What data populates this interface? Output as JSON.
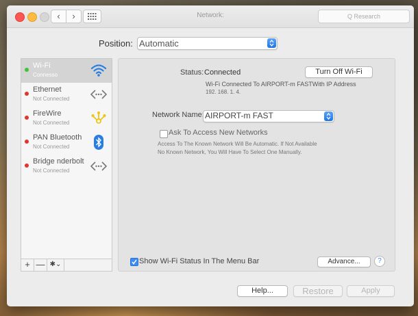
{
  "window": {
    "title": "Network:"
  },
  "toolbar": {
    "back_label": "‹",
    "forward_label": "›",
    "search_placeholder": "Q  Research"
  },
  "position": {
    "label": "Position:",
    "value": "Automatic"
  },
  "sidebar": {
    "items": [
      {
        "name": "Wi-Fi",
        "status": "Connesso",
        "dot_color": "#3cc43c",
        "icon": "wifi-icon",
        "selected": true
      },
      {
        "name": "Ethernet",
        "status": "Not Connected",
        "dot_color": "#e0362f",
        "icon": "ethernet-icon",
        "selected": false
      },
      {
        "name": "FireWire",
        "status": "Not Connected",
        "dot_color": "#e0362f",
        "icon": "firewire-icon",
        "selected": false
      },
      {
        "name": "PAN Bluetooth",
        "status": "Not Connected",
        "dot_color": "#e0362f",
        "icon": "bluetooth-icon",
        "selected": false
      },
      {
        "name": "Bridge   nderbolt",
        "status": "Not Connected",
        "dot_color": "#e0362f",
        "icon": "bridge-icon",
        "selected": false
      }
    ],
    "tools": {
      "add_label": "+",
      "remove_label": "—",
      "gear_label": "✱⌄"
    }
  },
  "detail": {
    "status_label": "Status:",
    "status_value": "Connected",
    "turn_off_label": "Turn Off Wi-Fi",
    "status_description": "Wi-Fi Connected To AIRPORT-m FASTWith IP Address",
    "ip_address": "192. 168. 1. 4.",
    "network_name_label": "Network Name:",
    "network_name_value": "AIRPORT-m FAST",
    "ask_label": "Ask To Access New Networks",
    "ask_checked": false,
    "ask_description_1": "Access To The Known Network Will Be Automatic. If Not Available",
    "ask_description_2": "No Known Network, You Will Have To Select One Manually.",
    "menubar_label": "Show Wi-Fi Status In The Menu Bar",
    "menubar_checked": true,
    "advanced_label": "Advance...",
    "help_label": "?"
  },
  "footer": {
    "help_label": "Help...",
    "restore_label": "Restore",
    "apply_label": "Apply"
  },
  "colors": {
    "accent": "#3b8df5",
    "selection": "#d4d4d4",
    "dot_connected": "#3cc43c",
    "dot_disconnected": "#e0362f",
    "firewire": "#f2c314"
  }
}
